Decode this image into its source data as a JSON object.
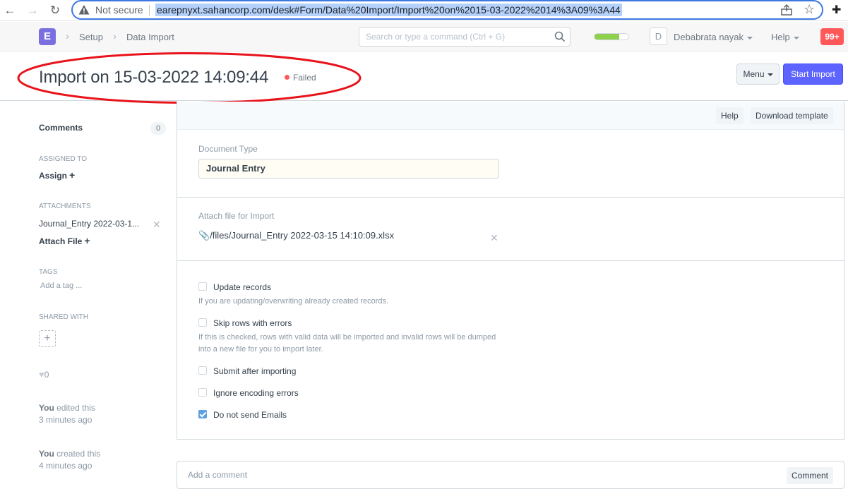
{
  "browser": {
    "security_label": "Not secure",
    "url": "earepnyxt.sahancorp.com/desk#Form/Data%20Import/Import%20on%2015-03-2022%2014%3A09%3A44"
  },
  "navbar": {
    "logo_letter": "E",
    "breadcrumbs": [
      "Setup",
      "Data Import"
    ],
    "search_placeholder": "Search or type a command (Ctrl + G)",
    "setup_progress": 0.72,
    "avatar_letter": "D",
    "user_name": "Debabrata nayak",
    "help_label": "Help",
    "notification_count": "99+"
  },
  "header": {
    "title": "Import on 15-03-2022 14:09:44",
    "status": "Failed",
    "status_color": "#ff5858",
    "menu_label": "Menu",
    "primary_action": "Start Import",
    "annotation_color": "#e8131b"
  },
  "sidebar": {
    "comments_label": "Comments",
    "comments_count": "0",
    "assigned_to_label": "ASSIGNED TO",
    "assign_label": "Assign",
    "attachments_label": "ATTACHMENTS",
    "attachment_name": "Journal_Entry 2022-03-1...",
    "attach_file_label": "Attach File",
    "tags_label": "TAGS",
    "add_tag_label": "Add a tag ...",
    "shared_with_label": "SHARED WITH",
    "likes_count": "0",
    "activity": [
      {
        "who": "You",
        "action": "edited this",
        "when": "3 minutes ago"
      },
      {
        "who": "You",
        "action": "created this",
        "when": "4 minutes ago"
      }
    ]
  },
  "form": {
    "toolbar": {
      "help_label": "Help",
      "download_template_label": "Download template"
    },
    "document_type_label": "Document Type",
    "document_type_value": "Journal Entry",
    "attach_label": "Attach file for Import",
    "attached_file": "/files/Journal_Entry 2022-03-15 14:10:09.xlsx",
    "options": {
      "update_records": {
        "label": "Update records",
        "checked": false,
        "description": "If you are updating/overwriting already created records."
      },
      "skip_rows": {
        "label": "Skip rows with errors",
        "checked": false,
        "description": "If this is checked, rows with valid data will be imported and invalid rows will be dumped into a new file for you to import later."
      },
      "submit_after": {
        "label": "Submit after importing",
        "checked": false
      },
      "ignore_encoding": {
        "label": "Ignore encoding errors",
        "checked": false
      },
      "no_emails": {
        "label": "Do not send Emails",
        "checked": true
      }
    }
  },
  "comment": {
    "placeholder": "Add a comment",
    "button_label": "Comment"
  }
}
